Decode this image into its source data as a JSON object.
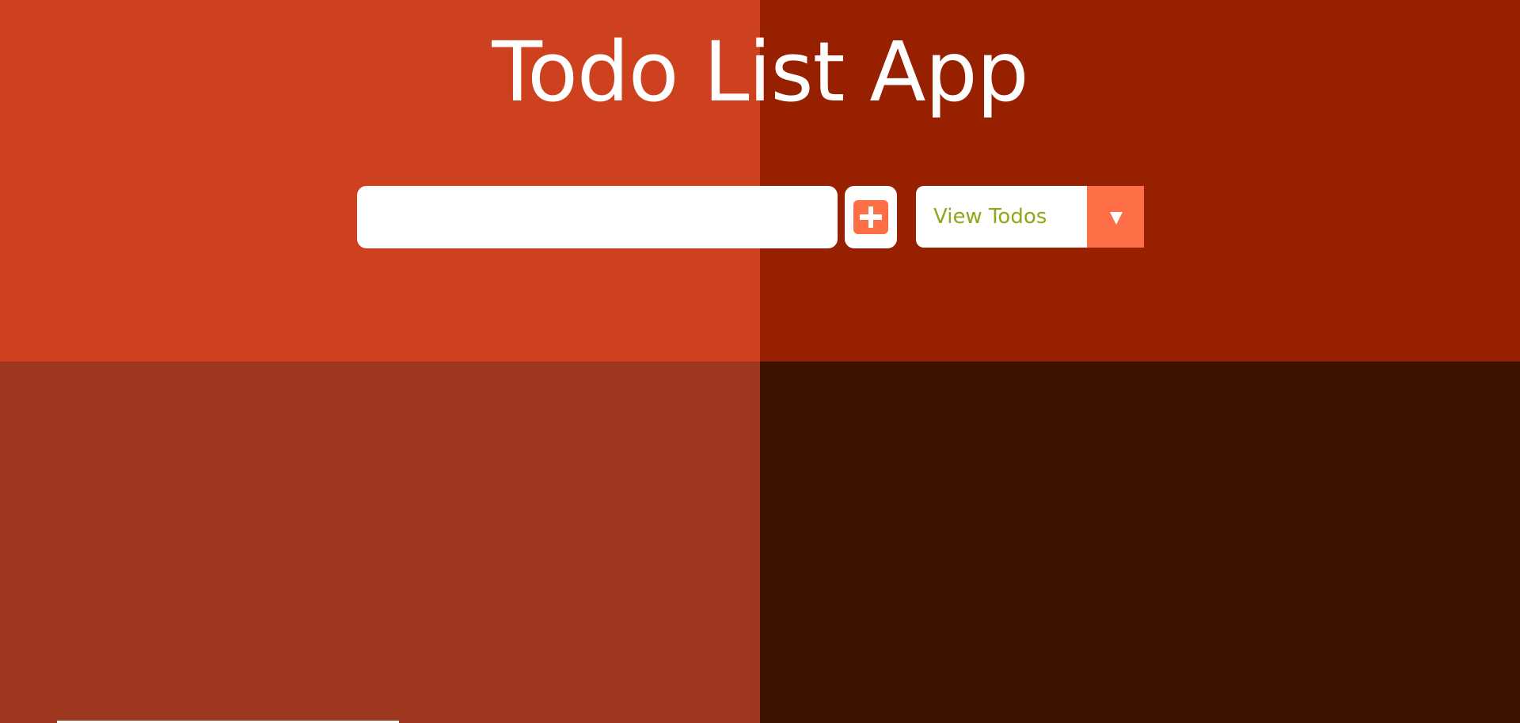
{
  "app": {
    "title": "Todo List App"
  },
  "todo_form": {
    "input_value": "",
    "input_placeholder": "",
    "add_icon": "plus-square-icon"
  },
  "filter": {
    "selected_label": "View Todos",
    "dropdown_icon": "chevron-down-icon"
  },
  "theme": {
    "quadrant_top_left": "#cd411f",
    "quadrant_top_right": "#962000",
    "quadrant_bottom_left": "#9e3720",
    "quadrant_bottom_right": "#3d1300",
    "accent": "#ff6f47",
    "select_text": "#8aaa19"
  }
}
